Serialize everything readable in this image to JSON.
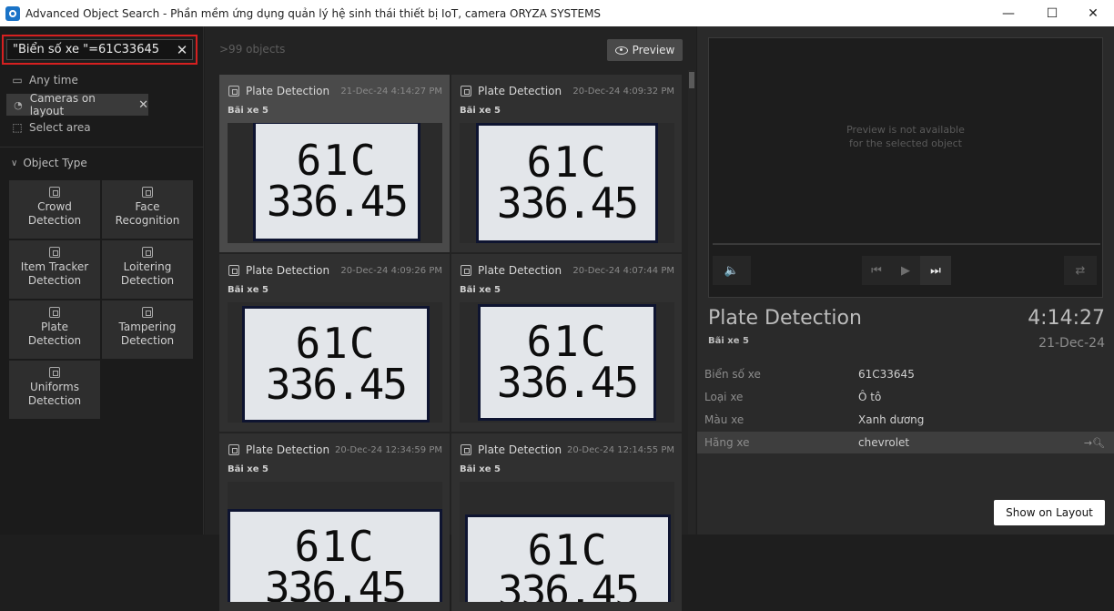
{
  "window": {
    "title": "Advanced Object Search - Phần mềm ứng dụng quản lý hệ sinh thái thiết bị IoT, camera ORYZA SYSTEMS",
    "minimize": "—",
    "maximize": "☐",
    "close": "✕"
  },
  "search": {
    "value": "\"Biển số xe \"=61C33645",
    "clear_icon": "✕"
  },
  "filters": {
    "time": "Any time",
    "cameras": "Cameras on layout",
    "area": "Select area"
  },
  "object_type": {
    "header": "Object Type",
    "items": [
      "Crowd\nDetection",
      "Face\nRecognition",
      "Item Tracker\nDetection",
      "Loitering\nDetection",
      "Plate\nDetection",
      "Tampering\nDetection",
      "Uniforms\nDetection"
    ]
  },
  "results": {
    "count": ">99 objects",
    "preview_label": "Preview",
    "cards": [
      {
        "title": "Plate Detection",
        "time": "21-Dec-24 4:14:27 PM",
        "location": "Bãi xe 5",
        "plate_l1": "61C",
        "plate_l2": "336.45"
      },
      {
        "title": "Plate Detection",
        "time": "20-Dec-24 4:09:32 PM",
        "location": "Bãi xe 5",
        "plate_l1": "61C",
        "plate_l2": "336.45"
      },
      {
        "title": "Plate Detection",
        "time": "20-Dec-24 4:09:26 PM",
        "location": "Bãi xe 5",
        "plate_l1": "61C",
        "plate_l2": "336.45"
      },
      {
        "title": "Plate Detection",
        "time": "20-Dec-24 4:07:44 PM",
        "location": "Bãi xe 5",
        "plate_l1": "61C",
        "plate_l2": "336.45"
      },
      {
        "title": "Plate Detection",
        "time": "20-Dec-24 12:34:59 PM",
        "location": "Bãi xe 5",
        "plate_l1": "61C",
        "plate_l2": "336.45"
      },
      {
        "title": "Plate Detection",
        "time": "20-Dec-24 12:14:55 PM",
        "location": "Bãi xe 5",
        "plate_l1": "61C",
        "plate_l2": "336.45"
      }
    ]
  },
  "preview": {
    "message": "Preview is not available\nfor the selected object"
  },
  "detail": {
    "title": "Plate Detection",
    "time": "4:14:27",
    "location": "Bãi xe 5",
    "date": "21-Dec-24",
    "properties": [
      {
        "key": "Biển số xe",
        "value": "61C33645"
      },
      {
        "key": "Loại xe",
        "value": "Ô tô"
      },
      {
        "key": "Màu xe",
        "value": "Xanh dương"
      },
      {
        "key": "Hãng xe",
        "value": "chevrolet"
      }
    ],
    "show_on_layout": "Show on Layout"
  }
}
